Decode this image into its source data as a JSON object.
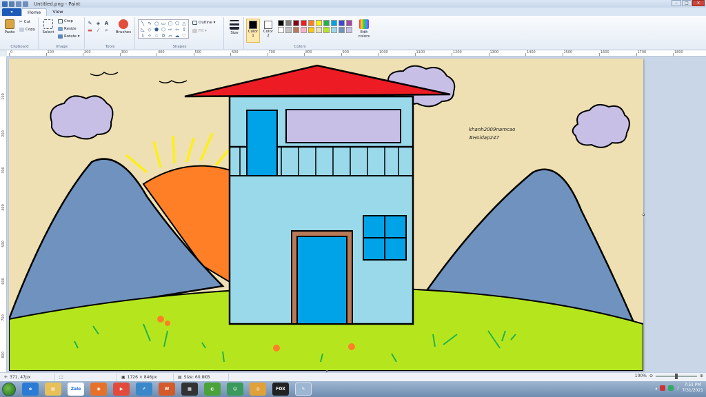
{
  "window": {
    "title": "Untitled.png - Paint",
    "buttons": {
      "minimize": "–",
      "maximize": "□",
      "close": "✕"
    }
  },
  "tabs": {
    "file": "▾",
    "home": "Home",
    "view": "View"
  },
  "ribbon": {
    "clipboard": {
      "label": "Clipboard",
      "paste": "Paste",
      "cut": "Cut",
      "copy": "Copy"
    },
    "image": {
      "label": "Image",
      "select": "Select",
      "crop": "Crop",
      "resize": "Resize",
      "rotate": "Rotate ▾"
    },
    "tools": {
      "label": "Tools",
      "brushes": "Brushes"
    },
    "shapes": {
      "label": "Shapes",
      "outline": "Outline ▾",
      "fill": "Fill ▾"
    },
    "size": {
      "label": "Size"
    },
    "colors": {
      "label": "Colors",
      "color1": "Color 1",
      "color2": "Color 2",
      "edit": "Edit colors",
      "color1_value": "#000000",
      "color2_value": "#ffffff",
      "palette": [
        "#000000",
        "#7f7f7f",
        "#880015",
        "#ed1c24",
        "#ff7f27",
        "#fff200",
        "#22b14c",
        "#00a2e8",
        "#3f48cc",
        "#a349a4",
        "#ffffff",
        "#c3c3c3",
        "#b97a57",
        "#ffaec9",
        "#ffc90e",
        "#efe4b0",
        "#b5e61d",
        "#99d9ea",
        "#7092be",
        "#c8bfe7"
      ]
    }
  },
  "ruler": {
    "h_ticks": [
      "0",
      "100",
      "200",
      "300",
      "400",
      "500",
      "600",
      "700",
      "800",
      "900",
      "1000",
      "1100",
      "1200",
      "1300",
      "1400",
      "1500",
      "1600",
      "1700",
      "1800"
    ],
    "v_ticks": [
      "100",
      "200",
      "300",
      "400",
      "500",
      "600",
      "700",
      "800"
    ]
  },
  "canvas": {
    "text_line1": "khanh2009namcao",
    "text_line2": "#Hoidap247",
    "colors": {
      "sky": "#eee0b2",
      "roof": "#ed1c24",
      "wall": "#99d9ea",
      "mountain": "#7092be",
      "sun": "#ff7f27",
      "grass": "#b5e61d",
      "cloud": "#c8bfe7",
      "door": "#00a2e8",
      "doorframe": "#b97a57"
    }
  },
  "status": {
    "cursor_pos": "371, 47px",
    "dimensions": "1726 × 846px",
    "size": "Size: 60.8KB",
    "zoom": "100%"
  },
  "taskbar": {
    "time": "7:51 PM",
    "date": "7/31/2021",
    "apps": [
      "ie",
      "explorer",
      "zalo",
      "firefox",
      "media-player",
      "paint-alt",
      "word",
      "photos",
      "file-manager",
      "chrome",
      "fox",
      "paint"
    ]
  }
}
